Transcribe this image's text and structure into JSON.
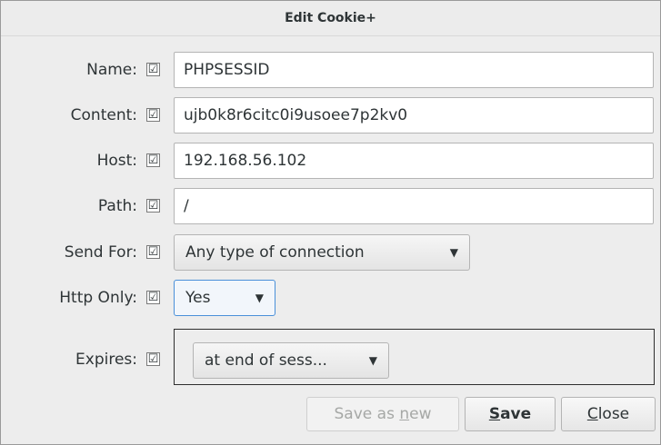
{
  "window": {
    "title": "Edit Cookie+"
  },
  "fields": {
    "name": {
      "label": "Name:",
      "checked": "☑",
      "value": "PHPSESSID"
    },
    "content": {
      "label": "Content:",
      "checked": "☑",
      "value": "ujb0k8r6citc0i9usoee7p2kv0"
    },
    "host": {
      "label": "Host:",
      "checked": "☑",
      "value": "192.168.56.102"
    },
    "path": {
      "label": "Path:",
      "checked": "☑",
      "value": "/"
    }
  },
  "send_for": {
    "label": "Send For:",
    "checked": "☑",
    "selected": "Any type of connection"
  },
  "http_only": {
    "label": "Http Only:",
    "checked": "☑",
    "selected": "Yes"
  },
  "expires": {
    "label": "Expires:",
    "checked": "☑",
    "selected": "at end of sess..."
  },
  "buttons": {
    "save_as_new": {
      "before": "Save as ",
      "mnemonic": "n",
      "after": "ew"
    },
    "save": {
      "before": "",
      "mnemonic": "S",
      "after": "ave"
    },
    "close": {
      "before": "",
      "mnemonic": "C",
      "after": "lose"
    }
  },
  "icons": {
    "dropdown": "triangle-down-icon",
    "checkbox": "checkbox-checked-icon"
  },
  "colors": {
    "focus": "#4a90d9",
    "background": "#ededed"
  }
}
